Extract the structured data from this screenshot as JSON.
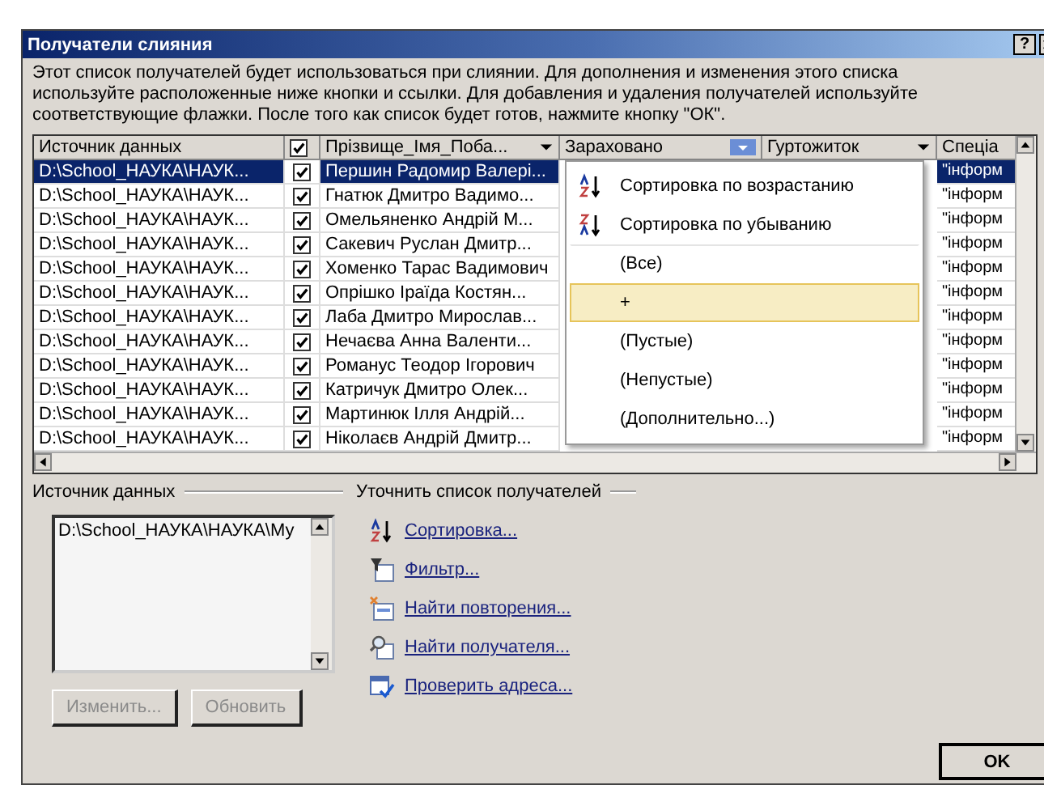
{
  "window": {
    "title": "Получатели слияния",
    "help_button": "?"
  },
  "description": "Этот список получателей будет использоваться при слиянии. Для дополнения и изменения этого списка используйте расположенные ниже кнопки и ссылки. Для добавления и удаления получателей используйте соответствующие флажки. После того как список будет готов, нажмите кнопку \"ОК\".",
  "table": {
    "columns": [
      {
        "kind": "text",
        "label": "Источник данных"
      },
      {
        "kind": "check",
        "checked": true
      },
      {
        "kind": "dropdown",
        "label": "Прізвище_Імя_Поба..."
      },
      {
        "kind": "filtered",
        "label": "Зараховано"
      },
      {
        "kind": "dropdown",
        "label": "Гуртожиток"
      },
      {
        "kind": "text",
        "label": "Спеціа"
      }
    ],
    "rows": [
      {
        "source": "D:\\School_НАУКА\\НАУК...",
        "checked": true,
        "name": "Першин Радомир Валері...",
        "column_6": "\"інформ",
        "selected": true
      },
      {
        "source": "D:\\School_НАУКА\\НАУК...",
        "checked": true,
        "name": "Гнатюк Дмитро Вадимо...",
        "column_6": "\"інформ",
        "selected": false
      },
      {
        "source": "D:\\School_НАУКА\\НАУК...",
        "checked": true,
        "name": "Омельяненко Андрій М...",
        "column_6": "\"інформ",
        "selected": false
      },
      {
        "source": "D:\\School_НАУКА\\НАУК...",
        "checked": true,
        "name": "Сакевич Руслан Дмитр...",
        "column_6": "\"інформ",
        "selected": false
      },
      {
        "source": "D:\\School_НАУКА\\НАУК...",
        "checked": true,
        "name": "Хоменко Тарас Вадимович",
        "column_6": "\"інформ",
        "selected": false
      },
      {
        "source": "D:\\School_НАУКА\\НАУК...",
        "checked": true,
        "name": "Опрішко Іраїда Костян...",
        "column_6": "\"інформ",
        "selected": false
      },
      {
        "source": "D:\\School_НАУКА\\НАУК...",
        "checked": true,
        "name": "Лаба Дмитро Мирослав...",
        "column_6": "\"інформ",
        "selected": false
      },
      {
        "source": "D:\\School_НАУКА\\НАУК...",
        "checked": true,
        "name": "Нечаєва Анна Валенти...",
        "column_6": "\"інформ",
        "selected": false
      },
      {
        "source": "D:\\School_НАУКА\\НАУК...",
        "checked": true,
        "name": "Романус Теодор Ігорович",
        "column_6": "\"інформ",
        "selected": false
      },
      {
        "source": "D:\\School_НАУКА\\НАУК...",
        "checked": true,
        "name": "Катричук Дмитро Олек...",
        "column_6": "\"інформ",
        "selected": false
      },
      {
        "source": "D:\\School_НАУКА\\НАУК...",
        "checked": true,
        "name": "Мартинюк Ілля Андрій...",
        "column_6": "\"інформ",
        "selected": false
      },
      {
        "source": "D:\\School_НАУКА\\НАУК...",
        "checked": true,
        "name": "Ніколаєв Андрій Дмитр...",
        "column_6": "\"інформ",
        "selected": false
      }
    ]
  },
  "filter_menu": {
    "items": [
      {
        "kind": "sort-asc",
        "label": "Сортировка по возрастанию",
        "selected": false
      },
      {
        "kind": "sort-desc",
        "label": "Сортировка по убыванию",
        "selected": false
      },
      {
        "kind": "option",
        "label": "(Все)",
        "selected": false
      },
      {
        "kind": "option",
        "label": "+",
        "selected": true
      },
      {
        "kind": "option",
        "label": "(Пустые)",
        "selected": false
      },
      {
        "kind": "option",
        "label": "(Непустые)",
        "selected": false
      },
      {
        "kind": "option",
        "label": "(Дополнительно...)",
        "selected": false
      }
    ]
  },
  "data_sources": {
    "label": "Источник данных",
    "items": [
      "D:\\School_НАУКА\\НАУКА\\Му"
    ],
    "buttons": [
      {
        "label": "Изменить...",
        "disabled": true
      },
      {
        "label": "Обновить",
        "disabled": true
      }
    ]
  },
  "refine": {
    "label": "Уточнить список получателей",
    "links": [
      {
        "kind": "sort",
        "label": "Сортировка..."
      },
      {
        "kind": "filter",
        "label": "Фильтр..."
      },
      {
        "kind": "duplicates",
        "label": "Найти повторения..."
      },
      {
        "kind": "find",
        "label": "Найти получателя..."
      },
      {
        "kind": "validate",
        "label": "Проверить адреса..."
      }
    ]
  },
  "ok_button": "OK"
}
